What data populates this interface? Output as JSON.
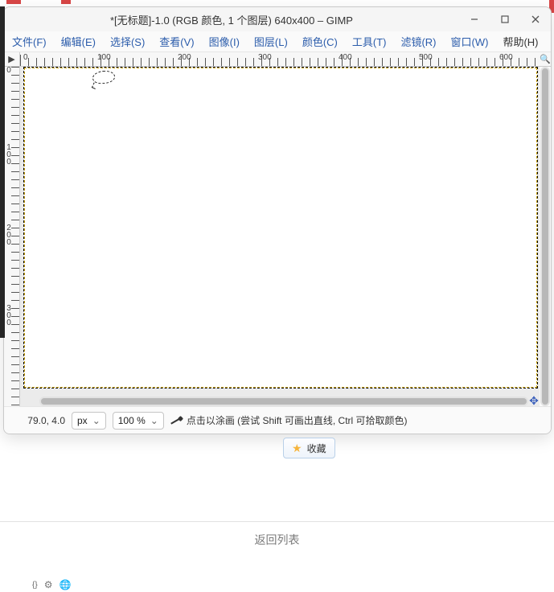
{
  "window": {
    "title": "*[无标题]-1.0 (RGB 颜色, 1 个图层) 640x400 – GIMP"
  },
  "menu": {
    "file": "文件(F)",
    "edit": "编辑(E)",
    "select": "选择(S)",
    "view": "查看(V)",
    "image": "图像(I)",
    "layer": "图层(L)",
    "colors": "颜色(C)",
    "tools": "工具(T)",
    "filters": "滤镜(R)",
    "windows": "窗口(W)",
    "help": "帮助(H)"
  },
  "ruler": {
    "h": [
      "0",
      "100",
      "200",
      "300",
      "400",
      "500",
      "600"
    ],
    "v": [
      "0",
      "100",
      "200",
      "300"
    ]
  },
  "status": {
    "coord": "79.0, 4.0",
    "unit": "px",
    "zoom": "100 %",
    "hint": "点击以涂画 (尝试 Shift 可画出直线, Ctrl 可拾取颜色)"
  },
  "behind": {
    "favorite": "收藏",
    "back_list": "返回列表"
  }
}
